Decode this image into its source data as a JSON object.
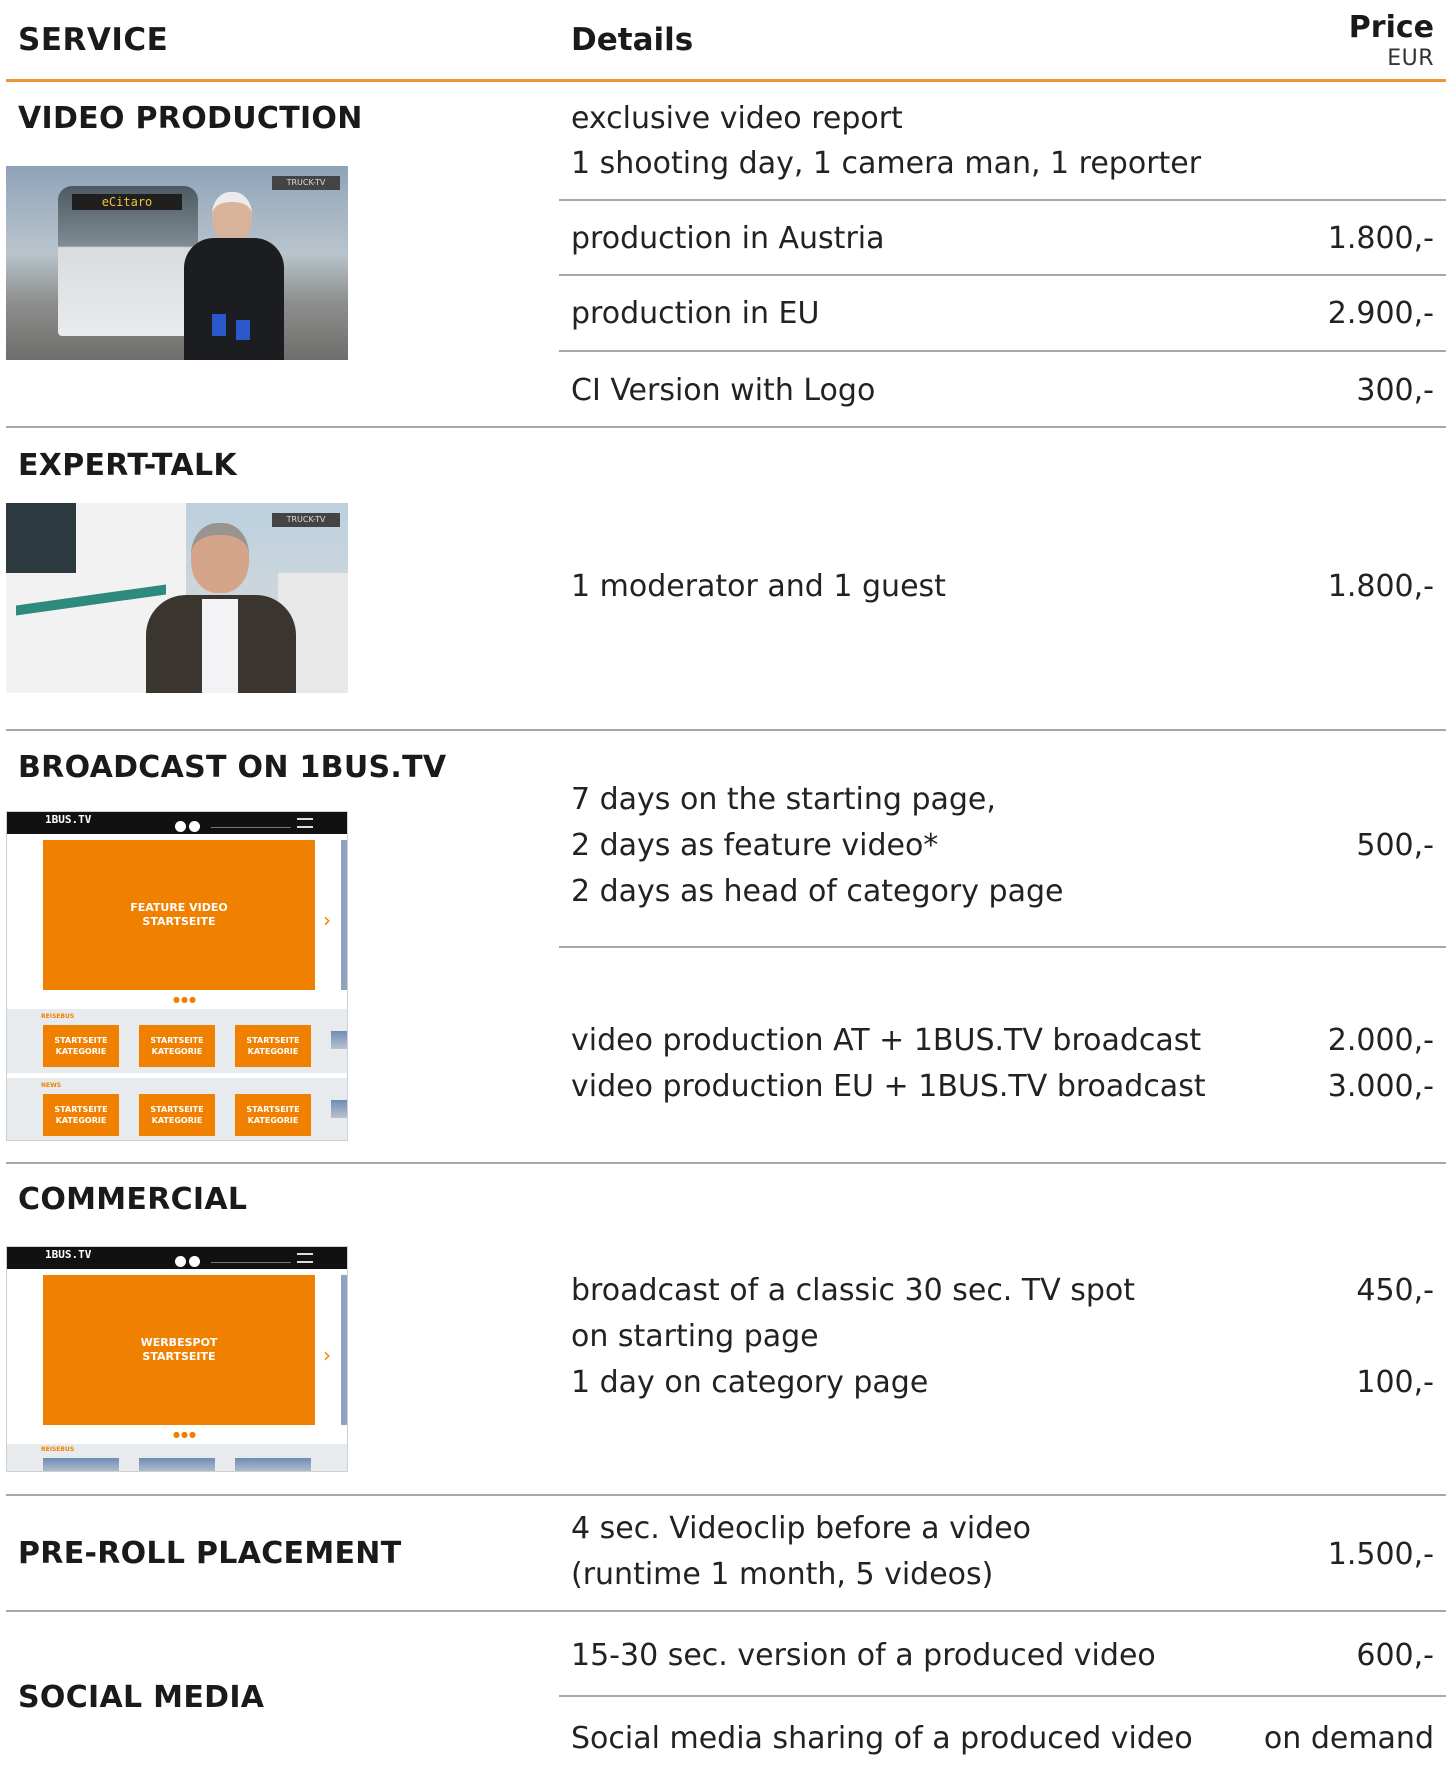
{
  "header": {
    "service": "SERVICE",
    "details": "Details",
    "price": "Price",
    "currency": "EUR"
  },
  "sections": {
    "video_production": {
      "title": "VIDEO PRODUCTION",
      "intro_1": "exclusive video report",
      "intro_2": "1 shooting day, 1 camera man, 1 reporter",
      "rows": [
        {
          "detail": "production in Austria",
          "price": "1.800,-"
        },
        {
          "detail": "production in EU",
          "price": "2.900,-"
        },
        {
          "detail": "CI Version with Logo",
          "price": "300,-"
        }
      ],
      "image": {
        "sign": "eCitaro",
        "watermark": "TRUCK-TV"
      }
    },
    "expert_talk": {
      "title": "EXPERT-TALK",
      "detail": "1 moderator and 1 guest",
      "price": "1.800,-",
      "image": {
        "watermark": "TRUCK-TV"
      }
    },
    "broadcast": {
      "title": "BROADCAST ON 1BUS.TV",
      "line_1": "7 days on the starting page,",
      "line_2": "2 days as feature video*",
      "line_3": "2 days as head of category page",
      "price": "500,-",
      "combo": [
        {
          "detail": "video production AT + 1BUS.TV broadcast",
          "price": "2.000,-"
        },
        {
          "detail": "video production EU + 1BUS.TV broadcast",
          "price": "3.000,-"
        }
      ],
      "mockup": {
        "brand": "1BUS.TV",
        "hero": "FEATURE VIDEO\nSTARTSEITE",
        "band1": "REISEBUS",
        "band2": "NEWS",
        "tile": "STARTSEITE\nKATEGORIE"
      }
    },
    "commercial": {
      "title": "COMMERCIAL",
      "line_1": "broadcast of a classic 30 sec. TV spot",
      "line_2": "on starting page",
      "line_3": "1 day on category page",
      "price_1": "450,-",
      "price_2": "100,-",
      "mockup": {
        "brand": "1BUS.TV",
        "hero": "WERBESPOT\nSTARTSEITE",
        "band1": "REISEBUS"
      }
    },
    "preroll": {
      "title": "PRE-ROLL PLACEMENT",
      "line_1": "4 sec. Videoclip before a video",
      "line_2": "(runtime 1 month, 5 videos)",
      "price": "1.500,-"
    },
    "social": {
      "title": "SOCIAL MEDIA",
      "rows": [
        {
          "detail": "15-30 sec. version of a produced video",
          "price": "600,-"
        },
        {
          "detail": "Social media sharing of a produced video",
          "price": "on demand"
        }
      ]
    }
  },
  "colors": {
    "accent": "#f08000",
    "rule": "#a8a8a8",
    "header_rule": "#f0963a"
  }
}
